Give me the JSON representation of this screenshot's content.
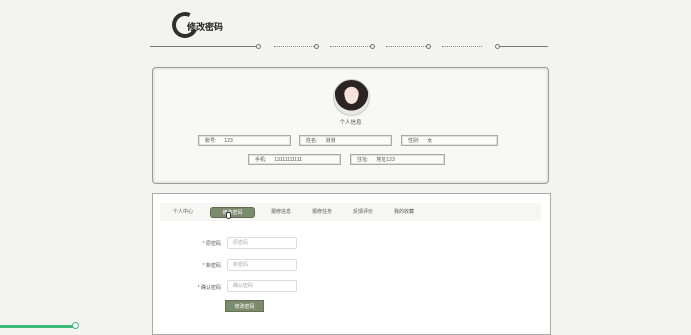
{
  "header": {
    "title": "修改密码"
  },
  "profile": {
    "section_title": "个人信息",
    "fields": [
      {
        "label": "账号:",
        "value": "123"
      },
      {
        "label": "姓名:",
        "value": "测测"
      },
      {
        "label": "性别:",
        "value": "女"
      },
      {
        "label": "手机:",
        "value": "13111111111"
      },
      {
        "label": "住址:",
        "value": "地址123"
      }
    ]
  },
  "tabs": [
    {
      "label": "个人中心"
    },
    {
      "label": "修改密码",
      "active": true
    },
    {
      "label": "报修信息"
    },
    {
      "label": "报修任务"
    },
    {
      "label": "反馈评价"
    },
    {
      "label": "我的收藏"
    }
  ],
  "form": {
    "old_password": {
      "label": "原密码",
      "placeholder": "原密码"
    },
    "new_password": {
      "label": "新密码",
      "placeholder": "新密码"
    },
    "confirm_password": {
      "label": "确认密码",
      "placeholder": "确认密码"
    },
    "required_mark": "*",
    "submit_label": "修改密码"
  },
  "colors": {
    "accent": "#7c8a6e",
    "background": "#f3f3f1",
    "progress": "#3cb878"
  },
  "icons": {
    "title": "ring-icon",
    "cursor": "mouse-cursor-icon"
  }
}
